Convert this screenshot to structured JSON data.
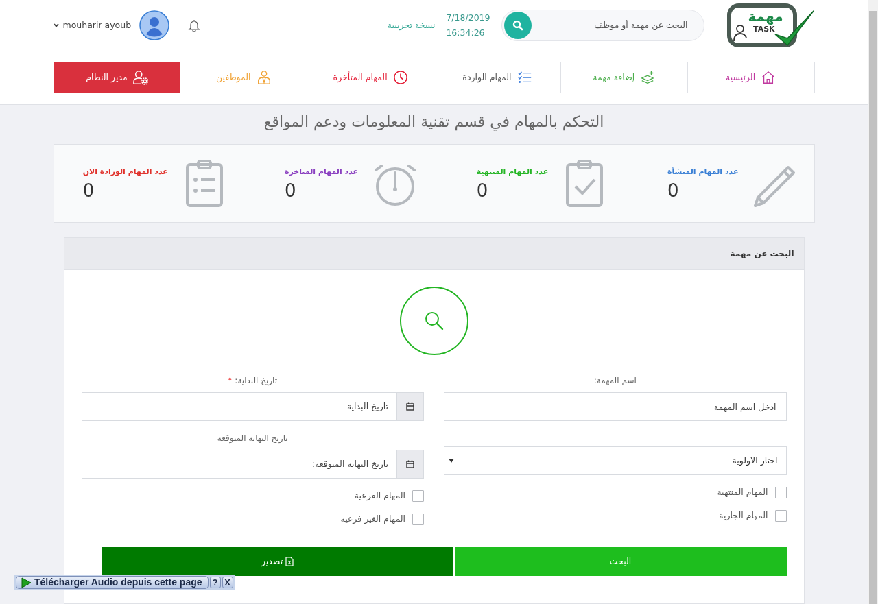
{
  "header": {
    "logo": {
      "word": "مهمة",
      "tag": "TASK"
    },
    "search": {
      "placeholder": "البحث عن مهمة أو موظف"
    },
    "date": "7/18/2019",
    "time": "16:34:26",
    "edition": "نسخة تجريبية",
    "user": "mouharir ayoub"
  },
  "nav": [
    {
      "label": "الرئيسية",
      "kind": "home",
      "color": "#c0399f",
      "selected": false
    },
    {
      "label": "إضافة مهمة",
      "kind": "add",
      "color": "#4cae4c",
      "selected": false
    },
    {
      "label": "المهام الواردة",
      "kind": "incoming",
      "color": "#3b7ddd",
      "selected": false
    },
    {
      "label": "المهام المتأخرة",
      "kind": "late",
      "color": "#e5223a",
      "selected": false
    },
    {
      "label": "الموظفين",
      "kind": "employees",
      "color": "#f0a030",
      "selected": false
    },
    {
      "label": "مدير النظام",
      "kind": "admin",
      "color": "#d9303d",
      "selected": true
    }
  ],
  "page_title": "التحكم بالمهام في قسم تقنية المعلومات ودعم المواقع",
  "stats": [
    {
      "label": "عدد المهام المنشأة",
      "value": "0",
      "kind": "created",
      "color": "#3a7fd5"
    },
    {
      "label": "عدد المهام المنتهية",
      "value": "0",
      "kind": "finished",
      "color": "#25b525"
    },
    {
      "label": "عدد المهام المتاخرة",
      "value": "0",
      "kind": "late",
      "color": "#8a3fc0"
    },
    {
      "label": "عدد المهام الورادة الان",
      "value": "0",
      "kind": "incoming",
      "color": "#e0302a"
    }
  ],
  "search_panel": {
    "title": "البحث عن مهمة",
    "name_field": {
      "label": "اسم المهمة:",
      "placeholder": "ادخل اسم المهمة"
    },
    "priority": {
      "value": "اختار الاولوية"
    },
    "start_field": {
      "label": "تاريخ البداية:",
      "required_mark": "*",
      "placeholder": "تاريخ البداية"
    },
    "end_field": {
      "label": "تاريخ النهاية المتوقعة",
      "placeholder": "تاريخ النهاية المتوقعة:"
    },
    "right_checks": [
      {
        "label": "المهام المنتهية",
        "checked": false
      },
      {
        "label": "المهام الجارية",
        "checked": false
      }
    ],
    "left_checks": [
      {
        "label": "المهام الفرعية",
        "checked": false
      },
      {
        "label": "المهام الغير فرعية",
        "checked": false
      }
    ],
    "search_button": "البحث",
    "export_button": "تصدير"
  },
  "extension_bar": {
    "label": "Télécharger Audio depuis cette page",
    "help": "?",
    "close": "X"
  }
}
